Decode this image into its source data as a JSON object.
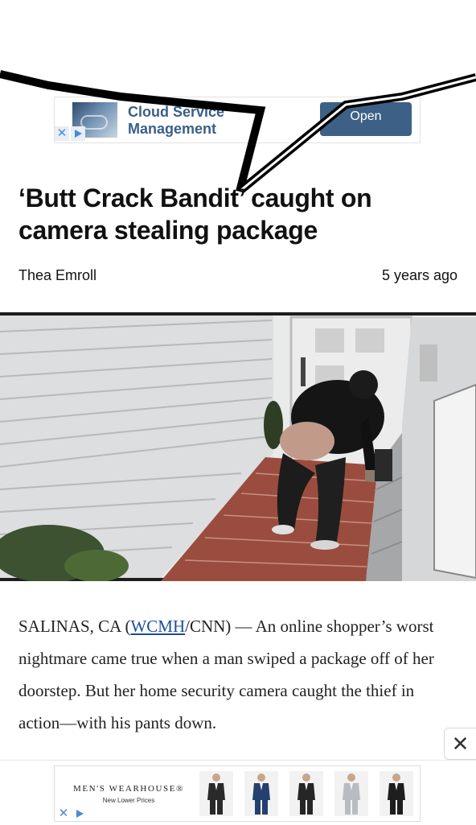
{
  "top_ad": {
    "text": "Cloud Service Management",
    "button_label": "Open"
  },
  "article": {
    "headline": "‘Butt Crack Bandit’ caught on camera stealing package",
    "author": "Thea Emroll",
    "time_ago": "5 years ago",
    "body_prefix": "SALINAS, CA (",
    "body_link": "WCMH",
    "body_rest": "/CNN) — An online shopper’s worst nightmare came true when a man swiped a package off of her doorstep. But her home security camera caught the thief in action—with his pants down."
  },
  "bottom_ad": {
    "brand": "MEN'S WEARHOUSE®",
    "tagline": "New Lower Prices",
    "suits": [
      {
        "jacket": "#2a2a2a"
      },
      {
        "jacket": "#24406e"
      },
      {
        "jacket": "#262626"
      },
      {
        "jacket": "#b7bcc2"
      },
      {
        "jacket": "#1e1e1e"
      }
    ]
  },
  "colors": {
    "ad_accent": "#3d6186",
    "link": "#1a4d9e",
    "annotation_stroke": "#000000"
  },
  "icons": {
    "close": "close-icon",
    "ad_choices": "adchoices-icon"
  }
}
